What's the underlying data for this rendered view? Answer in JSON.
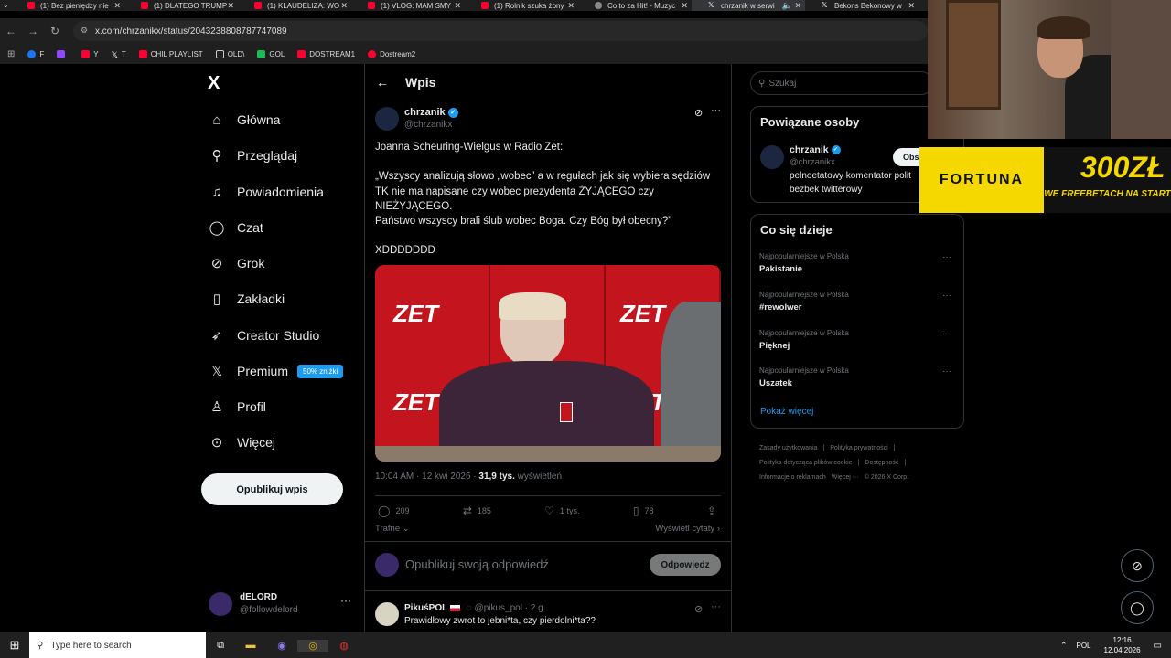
{
  "browser": {
    "tabs": [
      {
        "title": "(1) Bez pieniędzy nie"
      },
      {
        "title": "(1) DLATEGO TRUMP"
      },
      {
        "title": "(1) KLAUDELIZA: WO"
      },
      {
        "title": "(1) VLOG: MAM SMY"
      },
      {
        "title": "(1) Rolnik szuka żony"
      },
      {
        "title": "Co to za Hit! - Muzyc"
      },
      {
        "title": "chrzanik w serwi"
      },
      {
        "title": "Bekons Bekonowy w"
      }
    ],
    "url": "x.com/chrzanikx/status/2043238808787747089",
    "bookmarks": [
      "F",
      "Y",
      "T",
      "CHIL PLAYLIST",
      "OLD\\",
      "GOL",
      "DOSTREAM1",
      "Dostream2"
    ]
  },
  "sidebar": {
    "logo": "X",
    "items": [
      {
        "label": "Główna",
        "icon": "home-icon"
      },
      {
        "label": "Przeglądaj",
        "icon": "search-icon"
      },
      {
        "label": "Powiadomienia",
        "icon": "bell-icon"
      },
      {
        "label": "Czat",
        "icon": "chat-icon"
      },
      {
        "label": "Grok",
        "icon": "grok-icon"
      },
      {
        "label": "Zakładki",
        "icon": "bookmark-icon"
      },
      {
        "label": "Creator Studio",
        "icon": "rocket-icon"
      },
      {
        "label": "Premium",
        "icon": "x-icon",
        "badge": "50% zniżki"
      },
      {
        "label": "Profil",
        "icon": "person-icon"
      },
      {
        "label": "Więcej",
        "icon": "more-circle-icon"
      }
    ],
    "post_button": "Opublikuj wpis",
    "account": {
      "name": "dELORD",
      "handle": "@followdelord"
    }
  },
  "post": {
    "header_title": "Wpis",
    "author_name": "chrzanik",
    "author_handle": "@chrzanikx",
    "text_line1": "Joanna Scheuring-Wielgus w Radio Zet:",
    "text_line2": "„Wszyscy analizują słowo „wobec” a w regułach jak się wybiera sędziów",
    "text_line3": "TK nie ma napisane czy wobec prezydenta ŻYJĄCEGO czy",
    "text_line4": "NIEŻYJĄCEGO.",
    "text_line5": "Państwo wszyscy brali ślub wobec Boga. Czy Bóg był obecny?”",
    "text_line6": "XDDDDDDD",
    "media_logo": "ZET",
    "time": "10:04 AM · 12 kwi 2026 ·",
    "views_count": "31,9 tys.",
    "views_label": "wyświetleń",
    "replies": "209",
    "reposts": "185",
    "likes": "1 tys.",
    "bookmarks": "78",
    "sort_label": "Trafne",
    "quotes_label": "Wyświetl cytaty",
    "reply_placeholder": "Opublikuj swoją odpowiedź",
    "reply_button": "Odpowiedz"
  },
  "comment": {
    "author_name": "PikuśPOL",
    "author_handle": "@pikus_pol · 2 g.",
    "text": "Prawidłowy zwrot to jebni*ta, czy pierdolni*ta??"
  },
  "rightcol": {
    "search_placeholder": "Szukaj",
    "related_title": "Powiązane osoby",
    "related_name": "chrzanik",
    "related_handle": "@chrzanikx",
    "related_button": "Obs",
    "related_bio_line1": "pełnoetatowy komentator polit",
    "related_bio_line2": "bezbek twitterowy",
    "trends_title": "Co się dzieje",
    "trends": [
      {
        "category": "Najpopularniejsze w Polska",
        "name": "Pakistanie"
      },
      {
        "category": "Najpopularniejsze w Polska",
        "name": "#rewolwer"
      },
      {
        "category": "Najpopularniejsze w Polska",
        "name": "Pięknej"
      },
      {
        "category": "Najpopularniejsze w Polska",
        "name": "Uszatek"
      }
    ],
    "show_more": "Pokaż więcej",
    "footer_links": [
      "Zasady użytkowania",
      "|",
      "Polityka prywatności",
      "|",
      "Polityka dotycząca plików cookie",
      "|",
      "Dostępność",
      "|",
      "Informacje o reklamach",
      "Więcej ···",
      "© 2026 X Corp."
    ]
  },
  "ad": {
    "brand": "FORTUNA",
    "amount": "300ZŁ",
    "tagline": "WE FREEBETACH NA START"
  },
  "taskbar": {
    "search_placeholder": "Type here to search",
    "lang": "POL",
    "time": "12:16",
    "date": "12.04.2026"
  },
  "colors": {
    "accent": "#1d9bf0",
    "fortuna_yellow": "#f5d800",
    "zet_red": "#c4141e"
  }
}
